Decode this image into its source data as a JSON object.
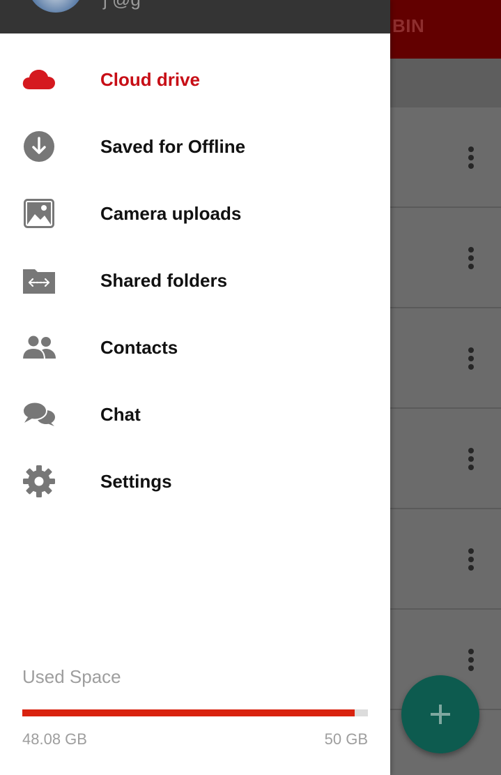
{
  "background": {
    "tab_label": "H BIN",
    "rows": 6
  },
  "header": {
    "email_fragment": "j @g"
  },
  "menu": {
    "items": [
      {
        "label": "Cloud drive",
        "icon": "cloud-icon",
        "active": true
      },
      {
        "label": "Saved for Offline",
        "icon": "download-icon",
        "active": false
      },
      {
        "label": "Camera uploads",
        "icon": "image-icon",
        "active": false
      },
      {
        "label": "Shared folders",
        "icon": "shared-folder-icon",
        "active": false
      },
      {
        "label": "Contacts",
        "icon": "contacts-icon",
        "active": false
      },
      {
        "label": "Chat",
        "icon": "chat-icon",
        "active": false
      },
      {
        "label": "Settings",
        "icon": "gear-icon",
        "active": false
      }
    ]
  },
  "storage": {
    "title": "Used Space",
    "used": "48.08 GB",
    "total": "50 GB",
    "used_fraction": 0.9616
  },
  "colors": {
    "accent": "#c70e16",
    "bar": "#d9230f",
    "fab": "#0d5b4f",
    "icon_gray": "#777777"
  }
}
